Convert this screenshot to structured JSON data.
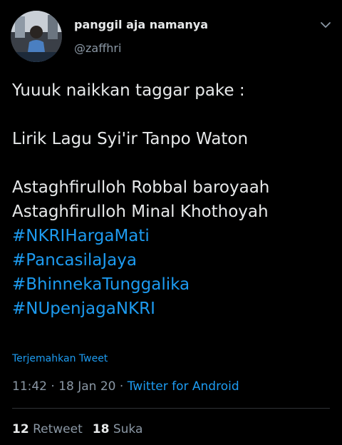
{
  "author": {
    "display_name": "panggil aja namanya",
    "handle": "@zaffhri"
  },
  "tweet": {
    "lines": [
      {
        "text": "Yuuuk naikkan taggar pake :",
        "hashtag": false
      },
      {
        "text": "",
        "hashtag": false
      },
      {
        "text": "Lirik Lagu Syi'ir Tanpo Waton",
        "hashtag": false
      },
      {
        "text": "",
        "hashtag": false
      },
      {
        "text": "Astaghfirulloh Robbal baroyaah",
        "hashtag": false
      },
      {
        "text": "Astaghfirulloh Minal Khothoyah",
        "hashtag": false
      },
      {
        "text": "#NKRIHargaMati",
        "hashtag": true
      },
      {
        "text": "#PancasilaJaya",
        "hashtag": true
      },
      {
        "text": "#BhinnekaTunggalika",
        "hashtag": true
      },
      {
        "text": "#NUpenjagaNKRI",
        "hashtag": true
      }
    ],
    "translate_label": "Terjemahkan Tweet",
    "time": "11:42",
    "date": "18 Jan 20",
    "separator": "·",
    "source": "Twitter for Android"
  },
  "stats": {
    "retweet_count": "12",
    "retweet_label": "Retweet",
    "like_count": "18",
    "like_label": "Suka"
  },
  "icons": {
    "chevron": "chevron-down-icon"
  },
  "colors": {
    "background": "#000000",
    "text": "#e7e9ea",
    "secondary": "#8b98a5",
    "link": "#1d9bf0"
  }
}
